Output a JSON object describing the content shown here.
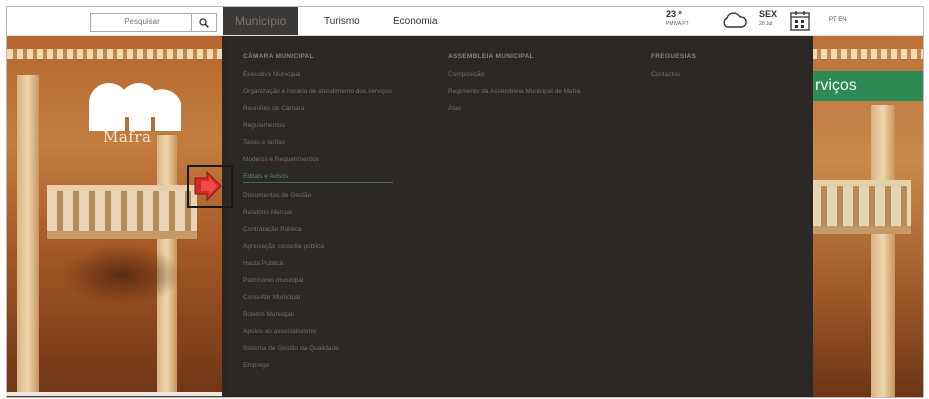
{
  "search": {
    "placeholder": "Pesquisar"
  },
  "nav": {
    "items": [
      {
        "label": "Município",
        "active": true
      },
      {
        "label": "Turismo",
        "active": false
      },
      {
        "label": "Economia",
        "active": false
      }
    ]
  },
  "weather": {
    "temp": "23 º",
    "location": "PMIVA PT",
    "icon": "cloud-icon"
  },
  "date": {
    "weekday": "SEX",
    "day": "20 Jul",
    "icon": "calendar-icon"
  },
  "languages": "PT EN",
  "brand": {
    "name": "Mafra",
    "logo_icon": "mafra-m-logo"
  },
  "services_button": "rviços",
  "menu": {
    "columns": [
      {
        "heading": "CÂMARA MUNICIPAL",
        "items": [
          "Executivo Municipal",
          "Organização e horário de atendimento dos serviços",
          "Reuniões de Câmara",
          "Regulamentos",
          "Taxas e tarifas",
          "Modelos e Requerimentos",
          "Editais e Avisos",
          "Documentos de Gestão",
          "Relatório Mensal",
          "Contratação Pública",
          "Apreciação consulta pública",
          "Hasta Pública",
          "Património municipal",
          "Consultar Municipal",
          "Boletim Municipal",
          "Apoios ao associativismo",
          "Sistema de Gestão da Qualidade",
          "Emprego"
        ],
        "active_index": 6
      },
      {
        "heading": "ASSEMBLEIA MUNICIPAL",
        "items": [
          "Composição",
          "Regimento da Assembleia Municipal de Mafra",
          "Atas"
        ]
      },
      {
        "heading": "FREGUESIAS",
        "items": [
          "Contactos"
        ]
      }
    ]
  },
  "colors": {
    "menu_bg": "#2b2825",
    "services_green": "#2e8a55",
    "highlight_red": "#d62a2a",
    "active_link": "#5d8a63"
  }
}
